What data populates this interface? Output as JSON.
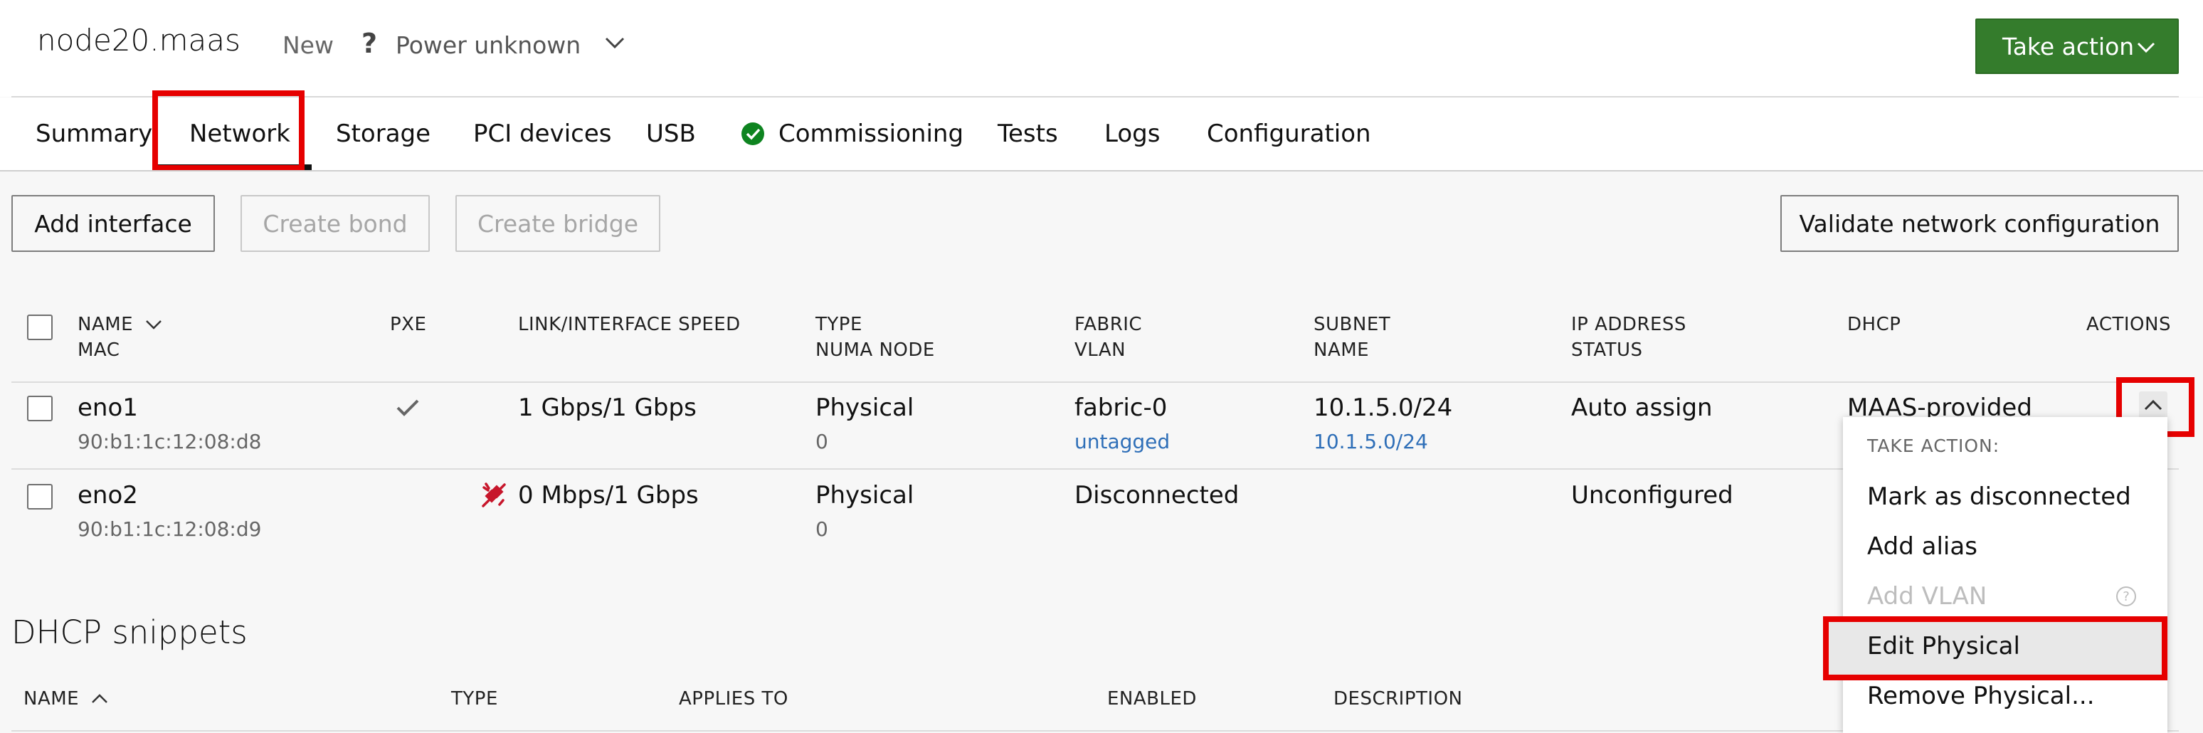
{
  "header": {
    "node_title": "node20.maas",
    "status": "New",
    "power_icon_glyph": "?",
    "power_status": "Power unknown",
    "take_action_label": "Take action",
    "take_action_color": "#347c2c"
  },
  "tabs": [
    {
      "label": "Summary"
    },
    {
      "label": "Network",
      "active": true
    },
    {
      "label": "Storage"
    },
    {
      "label": "PCI devices"
    },
    {
      "label": "USB"
    },
    {
      "label": "Commissioning",
      "icon": "check-circle-icon"
    },
    {
      "label": "Tests"
    },
    {
      "label": "Logs"
    },
    {
      "label": "Configuration"
    }
  ],
  "toolbar": {
    "add_interface": "Add interface",
    "create_bond": "Create bond",
    "create_bridge": "Create bridge",
    "validate": "Validate network configuration"
  },
  "table": {
    "headers": {
      "name": "NAME",
      "mac": "MAC",
      "pxe": "PXE",
      "speed": "LINK/INTERFACE SPEED",
      "type": "TYPE",
      "numa": "NUMA NODE",
      "fabric": "FABRIC",
      "vlan": "VLAN",
      "subnet": "SUBNET",
      "subnet_name": "NAME",
      "ip": "IP ADDRESS",
      "status": "STATUS",
      "dhcp": "DHCP",
      "actions": "ACTIONS"
    },
    "rows": [
      {
        "name": "eno1",
        "mac": "90:b1:1c:12:08:d8",
        "pxe": true,
        "speed": "1 Gbps/1 Gbps",
        "type": "Physical",
        "numa": "0",
        "fabric": "fabric-0",
        "vlan": "untagged",
        "subnet": "10.1.5.0/24",
        "subnet_name": "10.1.5.0/24",
        "ip": "Auto assign",
        "dhcp": "MAAS-provided"
      },
      {
        "name": "eno2",
        "mac": "90:b1:1c:12:08:d9",
        "pxe": false,
        "speed_icon": "disconnected-plug-icon",
        "speed": "0 Mbps/1 Gbps",
        "type": "Physical",
        "numa": "0",
        "fabric": "Disconnected",
        "ip": "Unconfigured"
      }
    ]
  },
  "actions_menu": {
    "header": "TAKE ACTION:",
    "items": [
      {
        "label": "Mark as disconnected"
      },
      {
        "label": "Add alias"
      },
      {
        "label": "Add VLAN",
        "disabled": true
      },
      {
        "label": "Edit Physical",
        "highlighted": true
      },
      {
        "label": "Remove Physical..."
      }
    ]
  },
  "dhcp_snippets": {
    "title": "DHCP snippets",
    "headers": {
      "name": "NAME",
      "type": "TYPE",
      "applies_to": "APPLIES TO",
      "enabled": "ENABLED",
      "description": "DESCRIPTION"
    }
  },
  "colors": {
    "highlight": "#e60000",
    "link": "#2f6fb8",
    "success": "#0e8420",
    "error": "#c7162b"
  }
}
